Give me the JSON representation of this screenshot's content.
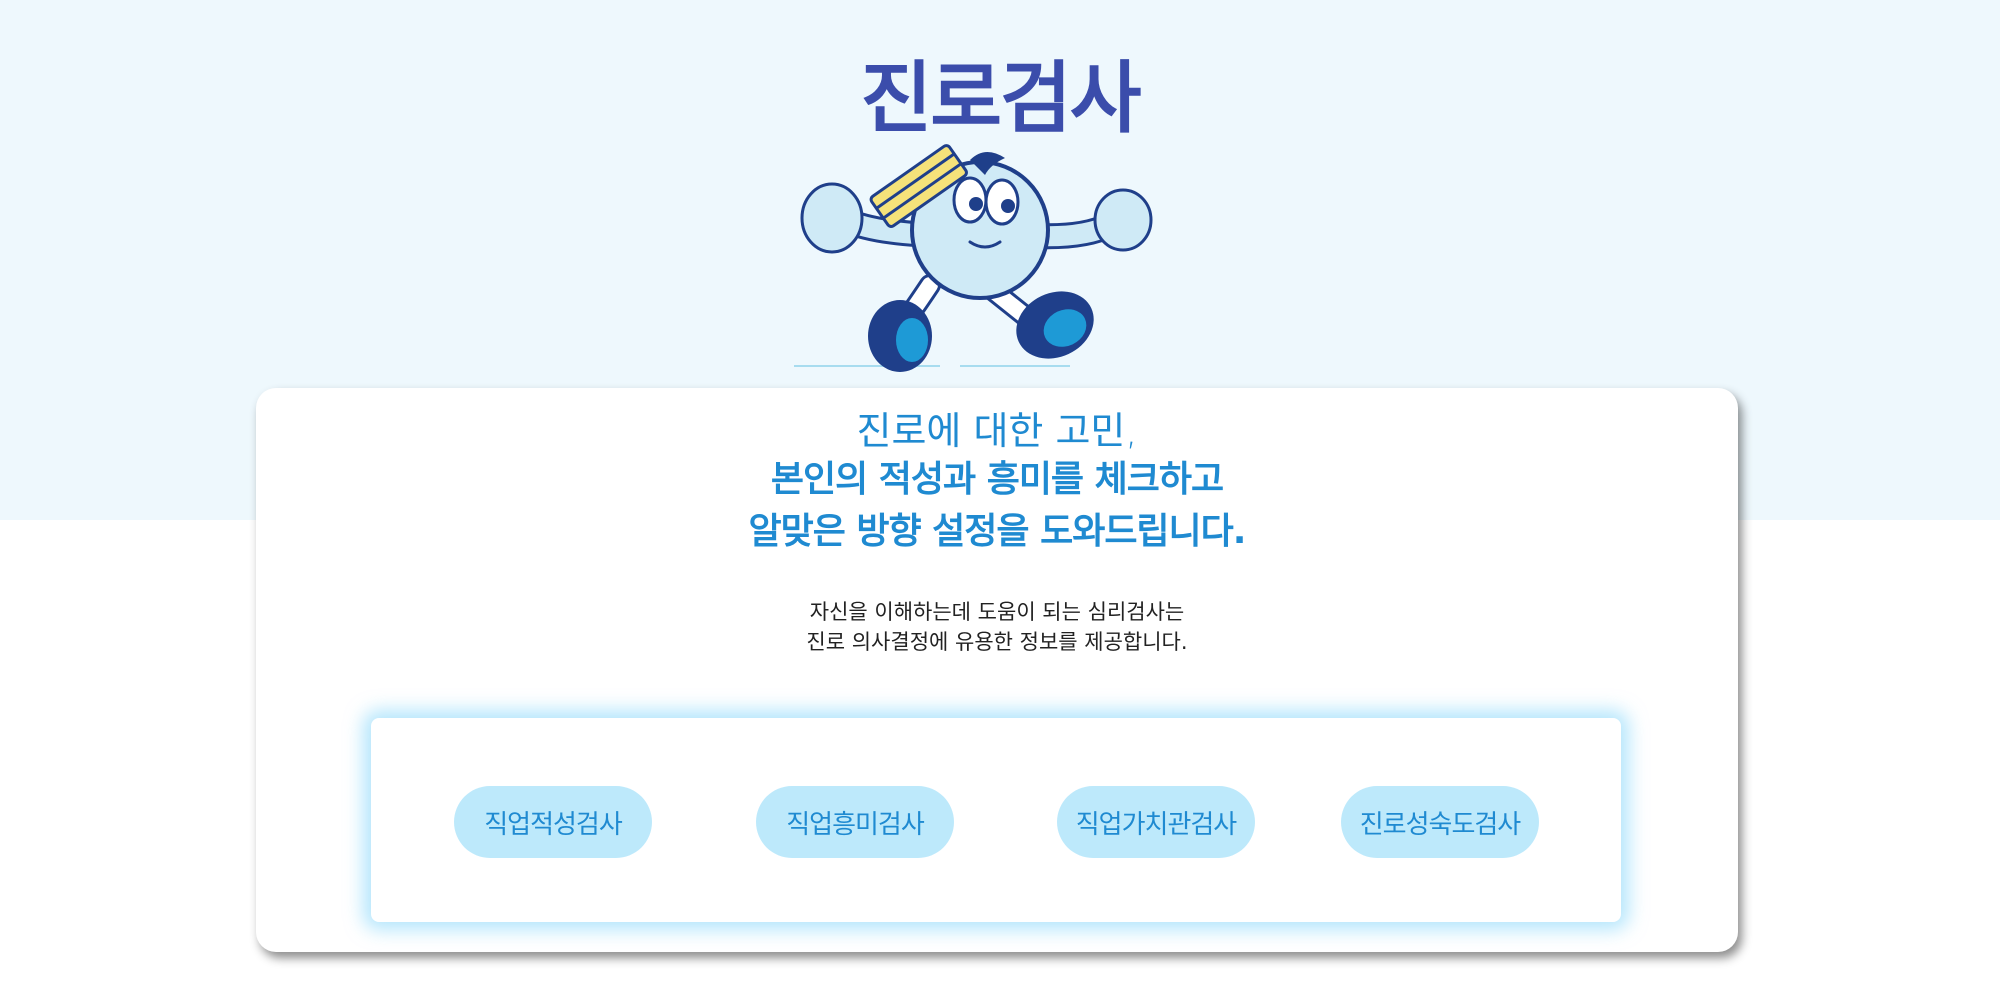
{
  "header": {
    "title": "진로검사"
  },
  "intro": {
    "line1": "진로에 대한 고민,",
    "line2": "본인의 적성과 흥미를 체크하고",
    "line3": "알맞은 방향 설정을 도와드립니다.",
    "desc1": "자신을 이해하는데 도움이 되는 심리검사는",
    "desc2": "진로 의사결정에 유용한 정보를 제공합니다."
  },
  "tests": [
    {
      "label": "직업적성검사"
    },
    {
      "label": "직업흥미검사"
    },
    {
      "label": "직업가치관검사"
    },
    {
      "label": "진로성숙도검사"
    }
  ],
  "colors": {
    "title": "#3b4dab",
    "accent": "#1f8ad1",
    "button_bg": "#bde9fb",
    "top_band": "#eef8fd"
  },
  "icons": {
    "mascot": "running-mascot-illustration"
  }
}
